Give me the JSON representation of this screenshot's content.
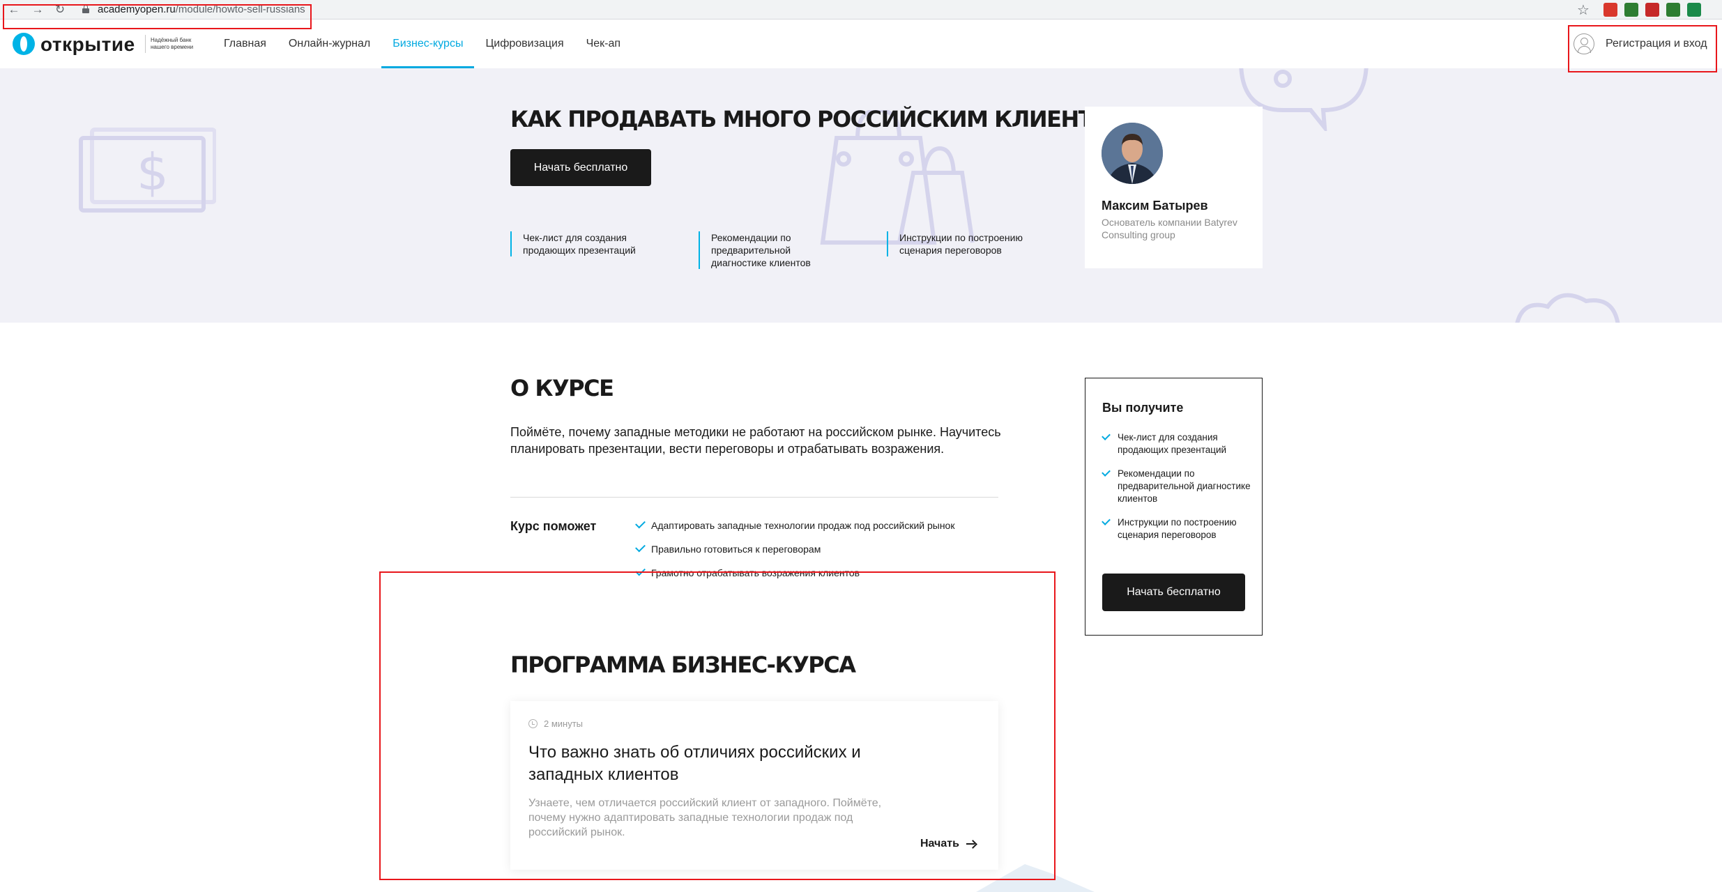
{
  "browser": {
    "url_host": "academyopen.ru",
    "url_path": "/module/howto-sell-russians",
    "back_glyph": "←",
    "forward_glyph": "→",
    "reload_glyph": "↻",
    "star_glyph": "☆",
    "extensions": [
      {
        "color": "#d9382c"
      },
      {
        "color": "#2e7d32"
      },
      {
        "color": "#c62828"
      },
      {
        "color": "#2e7d32"
      },
      {
        "color": "#1b8a4a"
      }
    ]
  },
  "header": {
    "logo_word": "открытие",
    "logo_tagline": "Надёжный банк нашего времени",
    "nav": [
      {
        "label": "Главная",
        "active": false
      },
      {
        "label": "Онлайн-журнал",
        "active": false
      },
      {
        "label": "Бизнес-курсы",
        "active": true
      },
      {
        "label": "Цифровизация",
        "active": false
      },
      {
        "label": "Чек-ап",
        "active": false
      }
    ],
    "login_label": "Регистрация и вход"
  },
  "hero": {
    "title": "КАК ПРОДАВАТЬ МНОГО РОССИЙСКИМ КЛИЕНТАМ",
    "cta_label": "Начать бесплатно",
    "features": [
      "Чек-лист для создания продающих презентаций",
      "Рекомендации по предварительной диагностике клиентов",
      "Инструкции по построению сценария переговоров"
    ],
    "author": {
      "name": "Максим Батырев",
      "role": "Основатель компании Batyrev Consulting group"
    }
  },
  "about": {
    "title": "О КУРСЕ",
    "text": "Поймёте, почему западные методики не работают на российском рынке. Научитесь планировать презентации, вести переговоры и отрабатывать возражения.",
    "helps_label": "Курс поможет",
    "helps_items": [
      "Адаптировать западные технологии продаж под российский рынок",
      "Правильно готовиться к переговорам",
      "Грамотно отрабатывать возражения клиентов"
    ]
  },
  "get_card": {
    "title": "Вы получите",
    "items": [
      "Чек-лист для создания продающих презентаций",
      "Рекомендации по предварительной диагностике клиентов",
      "Инструкции по построению сценария переговоров"
    ],
    "cta_label": "Начать бесплатно"
  },
  "program": {
    "title": "ПРОГРАММА БИЗНЕС-КУРСА",
    "lesson": {
      "duration": "2 минуты",
      "title": "Что важно знать об отличиях российских и западных клиентов",
      "description": "Узнаете, чем отличается российский клиент от западного. Поймёте, почему нужно адаптировать западные технологии продаж под российский рынок.",
      "start_label": "Начать"
    }
  },
  "colors": {
    "accent": "#00a9e0",
    "dark_button": "#1a1a1a",
    "hero_bg": "#f1f1f7",
    "annotation": "#e8161b"
  }
}
